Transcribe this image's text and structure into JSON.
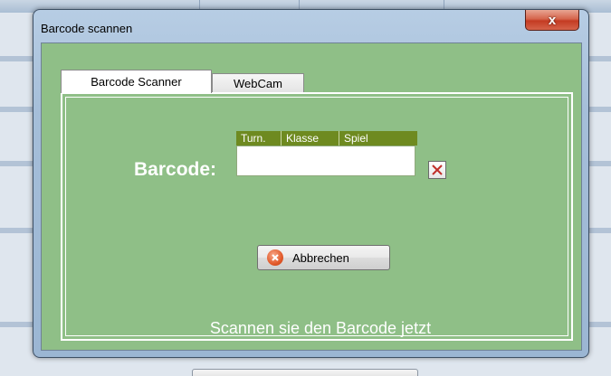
{
  "window": {
    "title": "Barcode scannen",
    "close_symbol": "x"
  },
  "tabs": [
    {
      "label": "Barcode Scanner",
      "active": true
    },
    {
      "label": "WebCam",
      "active": false
    }
  ],
  "barcode": {
    "label": "Barcode:",
    "value": "",
    "columns": [
      "Turn.",
      "Klasse",
      "Spiel"
    ]
  },
  "buttons": {
    "cancel_label": "Abbrechen"
  },
  "hint": "Scannen sie den Barcode jetzt",
  "icons": {
    "close": "close-icon",
    "clear": "clear-x-icon",
    "cancel": "cancel-icon"
  },
  "colors": {
    "panel_bg": "#8fbf87",
    "column_header_bg": "#6e8a20",
    "close_button": "#c9432a"
  }
}
